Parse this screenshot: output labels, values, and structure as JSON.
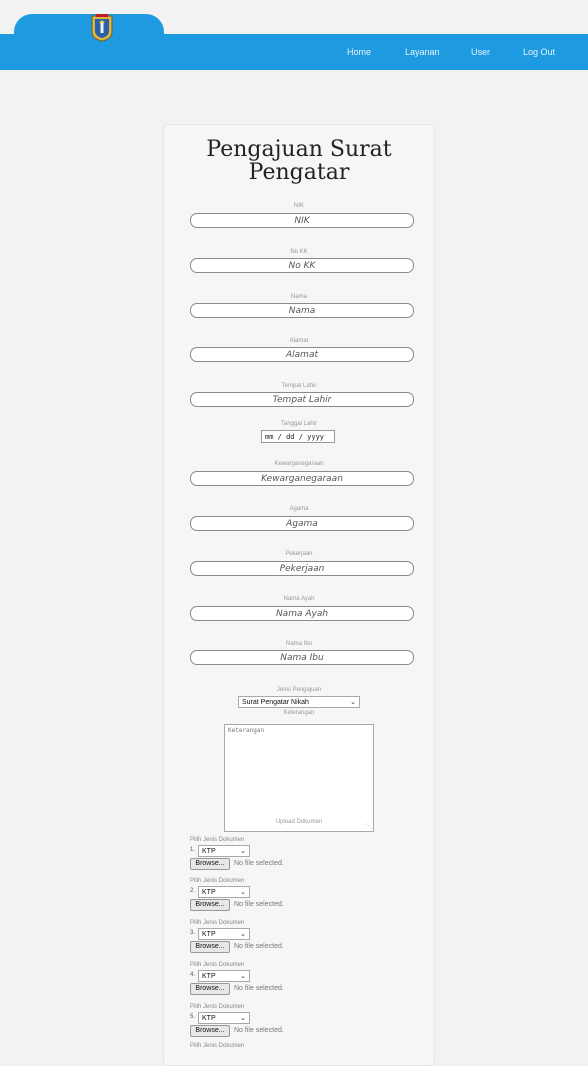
{
  "nav": {
    "links": [
      "Home",
      "Layanan",
      "User",
      "Log Out"
    ]
  },
  "form": {
    "title_line1": "Pengajuan Surat",
    "title_line2": "Pengatar",
    "fields": [
      {
        "label": "NIK",
        "placeholder": "NIK"
      },
      {
        "label": "No KK",
        "placeholder": "No KK"
      },
      {
        "label": "Nama",
        "placeholder": "Nama"
      },
      {
        "label": "Alamat",
        "placeholder": "Alamat"
      },
      {
        "label": "Tempat Lahir",
        "placeholder": "Tempat Lahir"
      }
    ],
    "tanggal": {
      "label": "Tanggal Lahir",
      "value": "mm / dd / yyyy"
    },
    "fields2": [
      {
        "label": "Kewarganegaraan",
        "placeholder": "Kewarganegaraan"
      },
      {
        "label": "Agama",
        "placeholder": "Agama"
      },
      {
        "label": "Pekerjaan",
        "placeholder": "Pekerjaan"
      },
      {
        "label": "Nama Ayah",
        "placeholder": "Nama Ayah"
      },
      {
        "label": "Nama Ibu",
        "placeholder": "Nama Ibu"
      }
    ],
    "jenis": {
      "label": "Jenis Pengajuan",
      "value": "Surat Pengatar Nikah"
    },
    "keterangan": {
      "label": "Keterangan",
      "placeholder": "Keterangan"
    },
    "upload_label": "Upload Dokumen",
    "documents": [
      {
        "label": "Pilih Jenis Dokumen",
        "number": "1.",
        "value": "KTP",
        "button": "Browse...",
        "status": "No file selected."
      },
      {
        "label": "Pilih Jenis Dokumen",
        "number": "2.",
        "value": "KTP",
        "button": "Browse...",
        "status": "No file selected."
      },
      {
        "label": "Pilih Jenis Dokumen",
        "number": "3.",
        "value": "KTP",
        "button": "Browse...",
        "status": "No file selected."
      },
      {
        "label": "Pilih Jenis Dokumen",
        "number": "4.",
        "value": "KTP",
        "button": "Browse...",
        "status": "No file selected."
      },
      {
        "label": "Pilih Jenis Dokumen",
        "number": "5.",
        "value": "KTP",
        "button": "Browse...",
        "status": "No file selected."
      }
    ],
    "last_doc_label": "Pilih Jenis Dokumen"
  },
  "colors": {
    "navbar": "#1e9be0",
    "background": "#f2f2f2",
    "card": "#f6f6f6"
  },
  "icons": {
    "logo": "jakarta-crest-icon",
    "chevron": "chevron-down-icon"
  }
}
